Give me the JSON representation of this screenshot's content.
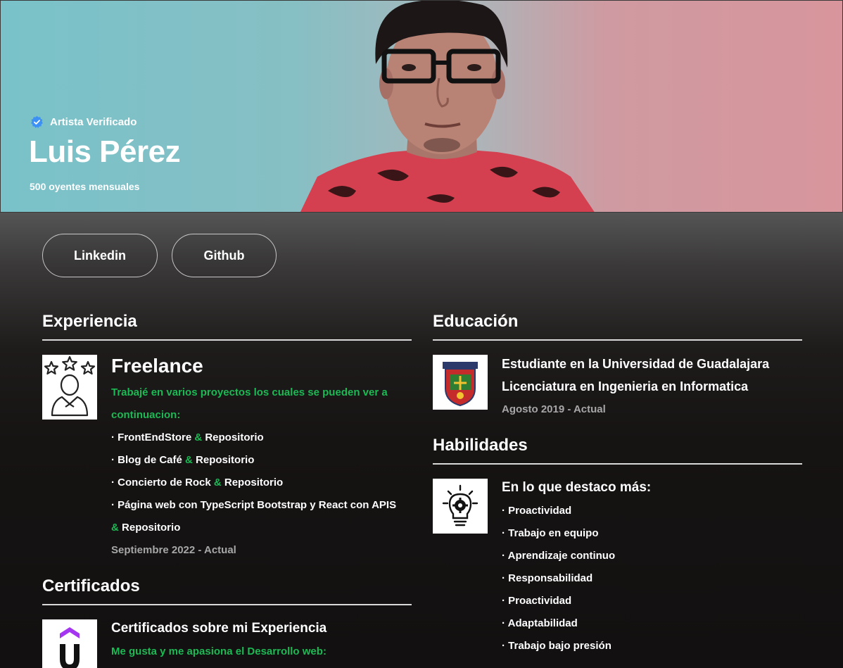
{
  "hero": {
    "verified_label": "Artista Verificado",
    "name": "Luis Pérez",
    "listeners": "500 oyentes mensuales",
    "gradient_left": "#79c2c9",
    "gradient_right": "#d8959c"
  },
  "links": [
    {
      "label": "Linkedin"
    },
    {
      "label": "Github"
    }
  ],
  "experience": {
    "title": "Experiencia",
    "icon": "user-stars-icon",
    "role": "Freelance",
    "intro_1": "Trabajé en varios proyectos los cuales se pueden ver a",
    "intro_2": "continuacion:",
    "projects": [
      {
        "name": "· FrontEndStore",
        "amp": "&",
        "repo": "Repositorio"
      },
      {
        "name": "· Blog de Café",
        "amp": "&",
        "repo": "Repositorio"
      },
      {
        "name": "· Concierto de Rock",
        "amp": "&",
        "repo": "Repositorio"
      },
      {
        "name": "· Página web con TypeScript Bootstrap y React con APIS",
        "amp": "&",
        "repo": "Repositorio"
      }
    ],
    "date": "Septiembre 2022 - Actual"
  },
  "certificates": {
    "title": "Certificados",
    "icon": "udemy-logo",
    "heading": "Certificados sobre mi Experiencia",
    "subtitle": "Me gusta y me apasiona el Desarrollo web:"
  },
  "education": {
    "title": "Educación",
    "icon": "university-crest-icon",
    "line_1": "Estudiante en la Universidad de Guadalajara",
    "line_2": "Licenciatura en Ingenieria en Informatica",
    "date": "Agosto 2019 - Actual"
  },
  "skills": {
    "title": "Habilidades",
    "icon": "lightbulb-gear-icon",
    "heading": "En lo que destaco más:",
    "items": [
      "· Proactividad",
      "· Trabajo en equipo",
      "· Aprendizaje continuo",
      "· Responsabilidad",
      "· Proactividad",
      "· Adaptabilidad",
      "· Trabajo bajo presión"
    ]
  },
  "colors": {
    "accent_green": "#1db954",
    "muted_text": "#a7a7a7",
    "verified_blue": "#3d91f4"
  }
}
